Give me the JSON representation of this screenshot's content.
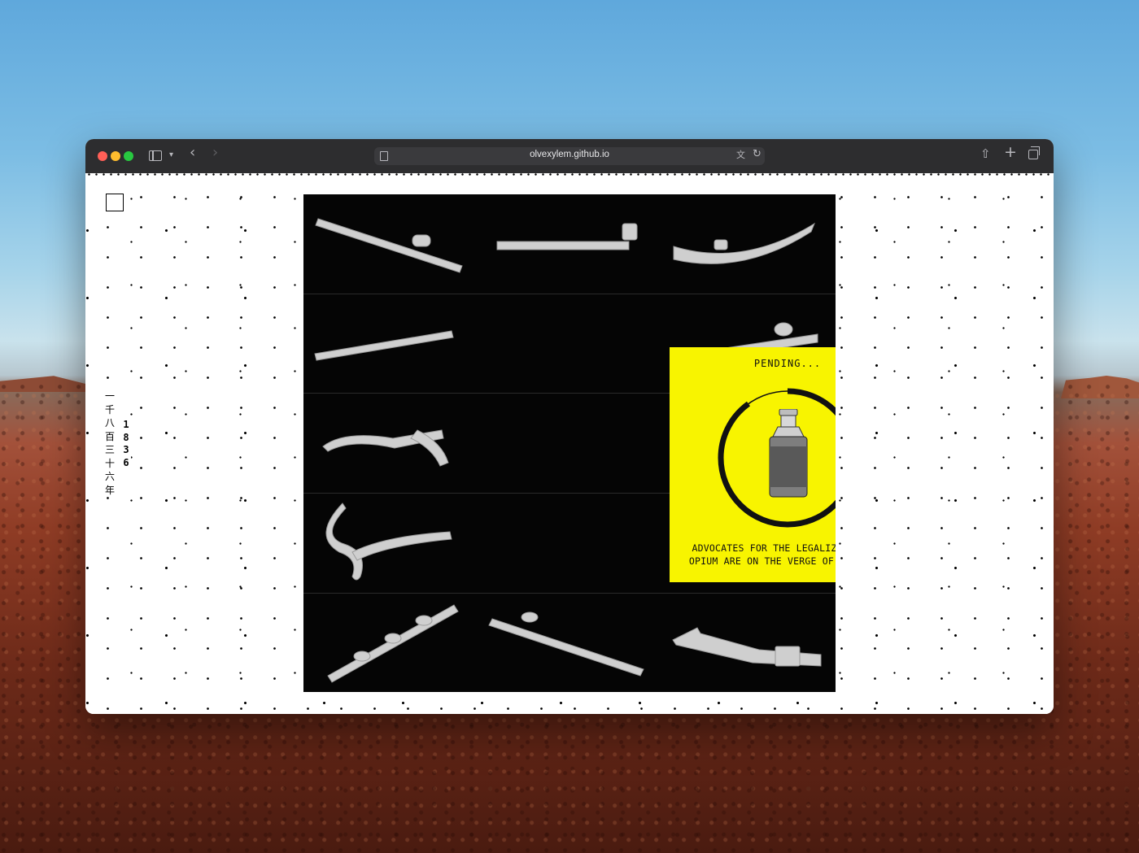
{
  "browser": {
    "url": "olvexylem.github.io"
  },
  "page": {
    "vertical_cjk": "一千八百三十六年",
    "vertical_year": "1836"
  },
  "modal": {
    "status": "PENDING...",
    "progress": 0.9,
    "message": "ADVOCATES FOR THE LEGALIZATION OF OPIUM ARE ON THE VERGE OF SUCCESS."
  },
  "colors": {
    "modal_bg": "#f8f400",
    "panel_bg": "#050505",
    "page_bg": "#ffffff"
  },
  "icons": [
    "sidebar-toggle-icon",
    "chevron-down-icon",
    "back-arrow-icon",
    "forward-arrow-icon",
    "page-icon",
    "translate-icon",
    "reload-icon",
    "share-icon",
    "new-tab-icon",
    "tab-overview-icon",
    "menu-square-icon",
    "opium-bottle-icon",
    "hand-cursor-icon",
    "opium-pipe-icon"
  ]
}
